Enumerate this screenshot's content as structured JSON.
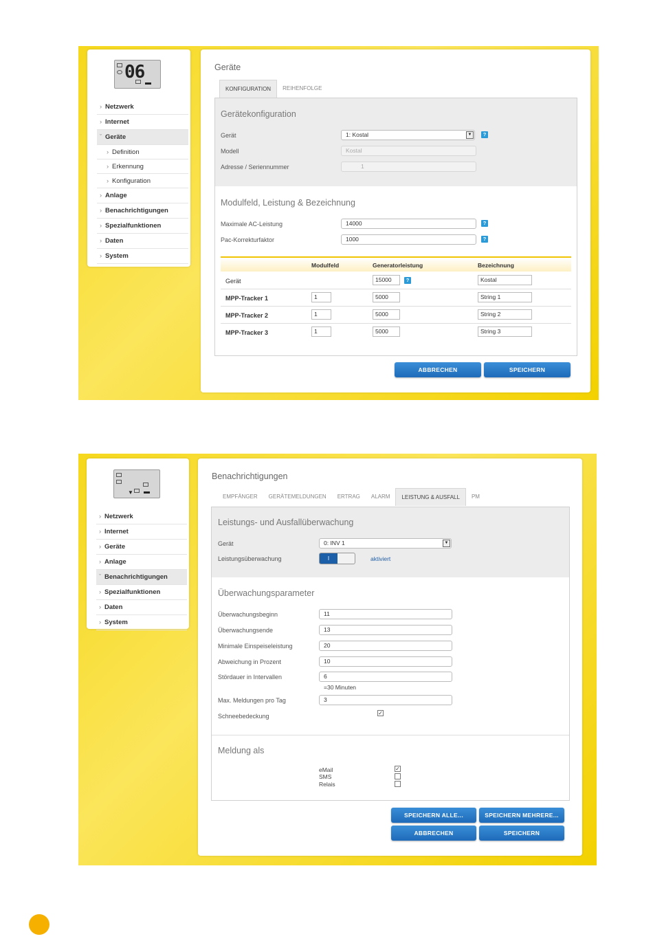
{
  "screen1": {
    "lcd_digits": "06",
    "nav": [
      {
        "label": "Netzwerk"
      },
      {
        "label": "Internet"
      },
      {
        "label": "Geräte"
      },
      {
        "label": "Definition"
      },
      {
        "label": "Erkennung"
      },
      {
        "label": "Konfiguration"
      },
      {
        "label": "Anlage"
      },
      {
        "label": "Benachrichtigungen"
      },
      {
        "label": "Spezialfunktionen"
      },
      {
        "label": "Daten"
      },
      {
        "label": "System"
      }
    ],
    "title": "Geräte",
    "tabs": [
      "KONFIGURATION",
      "REIHENFOLGE"
    ],
    "section1_title": "Gerätekonfiguration",
    "geraet_label": "Gerät",
    "geraet_value": "1: Kostal",
    "modell_label": "Modell",
    "modell_value": "Kostal",
    "adresse_label": "Adresse / Seriennummer",
    "adresse_value": "1",
    "section2_title": "Modulfeld, Leistung & Bezeichnung",
    "max_ac_label": "Maximale AC-Leistung",
    "max_ac_value": "14000",
    "pac_label": "Pac-Korrekturfaktor",
    "pac_value": "1000",
    "help": "?",
    "table": {
      "headers": [
        "Modulfeld",
        "Generatorleistung",
        "Bezeichnung"
      ],
      "rows": [
        {
          "name": "Gerät",
          "modulfeld": "",
          "generator": "15000",
          "bezeichnung": "Kostal"
        },
        {
          "name": "MPP-Tracker 1",
          "modulfeld": "1",
          "generator": "5000",
          "bezeichnung": "String 1"
        },
        {
          "name": "MPP-Tracker 2",
          "modulfeld": "1",
          "generator": "5000",
          "bezeichnung": "String 2"
        },
        {
          "name": "MPP-Tracker 3",
          "modulfeld": "1",
          "generator": "5000",
          "bezeichnung": "String 3"
        }
      ]
    },
    "btn_cancel": "ABBRECHEN",
    "btn_save": "SPEICHERN"
  },
  "screen2": {
    "nav": [
      {
        "label": "Netzwerk"
      },
      {
        "label": "Internet"
      },
      {
        "label": "Geräte"
      },
      {
        "label": "Anlage"
      },
      {
        "label": "Benachrichtigungen"
      },
      {
        "label": "Spezialfunktionen"
      },
      {
        "label": "Daten"
      },
      {
        "label": "System"
      }
    ],
    "title": "Benachrichtigungen",
    "tabs": [
      "EMPFÄNGER",
      "GERÄTEMELDUNGEN",
      "ERTRAG",
      "ALARM",
      "LEISTUNG & AUSFALL",
      "PM"
    ],
    "section1_title": "Leistungs- und Ausfallüberwachung",
    "geraet_label": "Gerät",
    "geraet_value": "0: INV 1",
    "leistung_label": "Leistungsüberwachung",
    "toggle_on": "I",
    "toggle_status": "aktiviert",
    "section2_title": "Überwachungsparameter",
    "params": [
      {
        "label": "Überwachungsbeginn",
        "value": "11"
      },
      {
        "label": "Überwachungsende",
        "value": "13"
      },
      {
        "label": "Minimale Einspeiseleistung",
        "value": "20"
      },
      {
        "label": "Abweichung in Prozent",
        "value": "10"
      },
      {
        "label": "Stördauer in Intervallen",
        "value": "6"
      },
      {
        "label": "Max. Meldungen pro Tag",
        "value": "3"
      }
    ],
    "interval_note": "=30 Minuten",
    "schnee_label": "Schneebedeckung",
    "section3_title": "Meldung als",
    "meldung": [
      {
        "label": "eMail",
        "checked": true
      },
      {
        "label": "SMS",
        "checked": false
      },
      {
        "label": "Relais",
        "checked": false
      }
    ],
    "btn_save_all": "SPEICHERN ALLE...",
    "btn_save_multi": "SPEICHERN MEHRERE...",
    "btn_cancel": "ABBRECHEN",
    "btn_save": "SPEICHERN"
  }
}
